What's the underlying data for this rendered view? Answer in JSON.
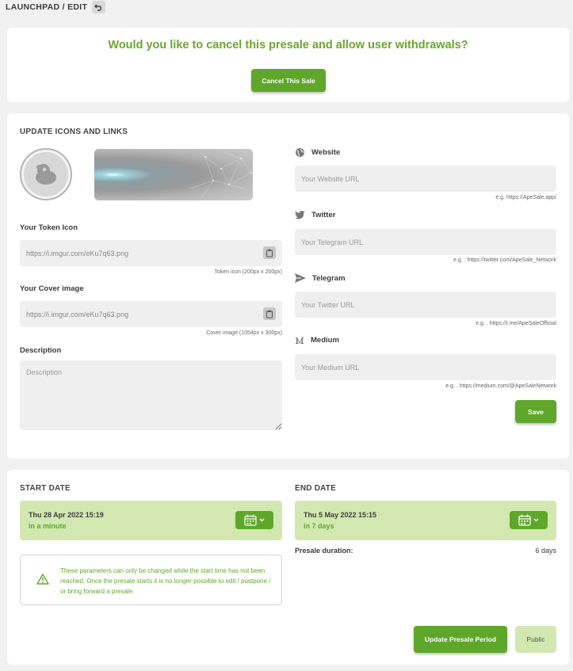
{
  "breadcrumb": "LAUNCHPAD / EDIT",
  "cancel": {
    "question": "Would you like to cancel this presale and allow user withdrawals?",
    "button": "Cancel This Sale"
  },
  "update": {
    "title": "UPDATE ICONS AND LINKS",
    "token_icon_label": "Your Token Icon",
    "token_icon_value": "https://i.imgur.com/eKu7q63.png",
    "token_icon_hint": "Token icon (200px x 200px)",
    "cover_label": "Your Cover image",
    "cover_value": "https://i.imgur.com/eKu7q63.png",
    "cover_hint": "Cover image (1054px x 300px)",
    "description_label": "Description",
    "description_placeholder": "Description",
    "website_label": "Website",
    "website_placeholder": "Your Website URL",
    "website_hint": "e.g. https://ApeSale.app/",
    "twitter_label": "Twitter",
    "twitter_placeholder": "Your Telegram URL",
    "twitter_hint": "e.g. . https://twitter.com/ApeSale_Network",
    "telegram_label": "Telegram",
    "telegram_placeholder": "Your Twitter URL",
    "telegram_hint": "e.g. . https://t.me/ApeSaleOfficial",
    "medium_label": "Medium",
    "medium_placeholder": "Your Medium URL",
    "medium_hint": "e.g. . https://medium.com/@ApeSaleNetwork",
    "save_button": "Save"
  },
  "dates": {
    "start_title": "START DATE",
    "start_date": "Thu 28 Apr 2022 15:19",
    "start_relative": "in a minute",
    "end_title": "END DATE",
    "end_date": "Thu 5 May 2022 15:15",
    "end_relative": "in 7 days",
    "duration_label": "Presale duration:",
    "duration_value": "6 days",
    "notice": "These parameters can only be changed while the start time has not been reached. Once the presale starts it is no longer possible to edit / postpone / or bring forward a presale.",
    "update_button": "Update Presale Period",
    "public_button": "Public"
  },
  "colors": {
    "accent": "#5fa72a",
    "accent_light": "#d2e8b0",
    "heading_green": "#6aa72f"
  }
}
